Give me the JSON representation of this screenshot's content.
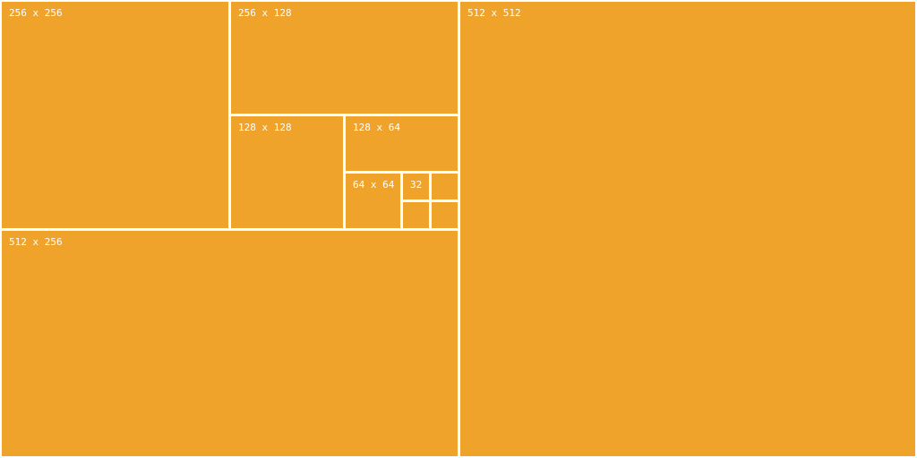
{
  "colors": {
    "tile_fill": "#efa32b",
    "divider": "#ffffff",
    "label_text": "#ffffff"
  },
  "tiles": {
    "t256x256": {
      "label": "256 x 256"
    },
    "t256x128": {
      "label": "256 x 128"
    },
    "t128x128": {
      "label": "128 x 128"
    },
    "t128x64": {
      "label": "128 x 64"
    },
    "t64x64": {
      "label": "64 x 64"
    },
    "t32": {
      "label": "32"
    },
    "t512x256": {
      "label": "512 x 256"
    },
    "t512x512": {
      "label": "512 x 512"
    }
  }
}
